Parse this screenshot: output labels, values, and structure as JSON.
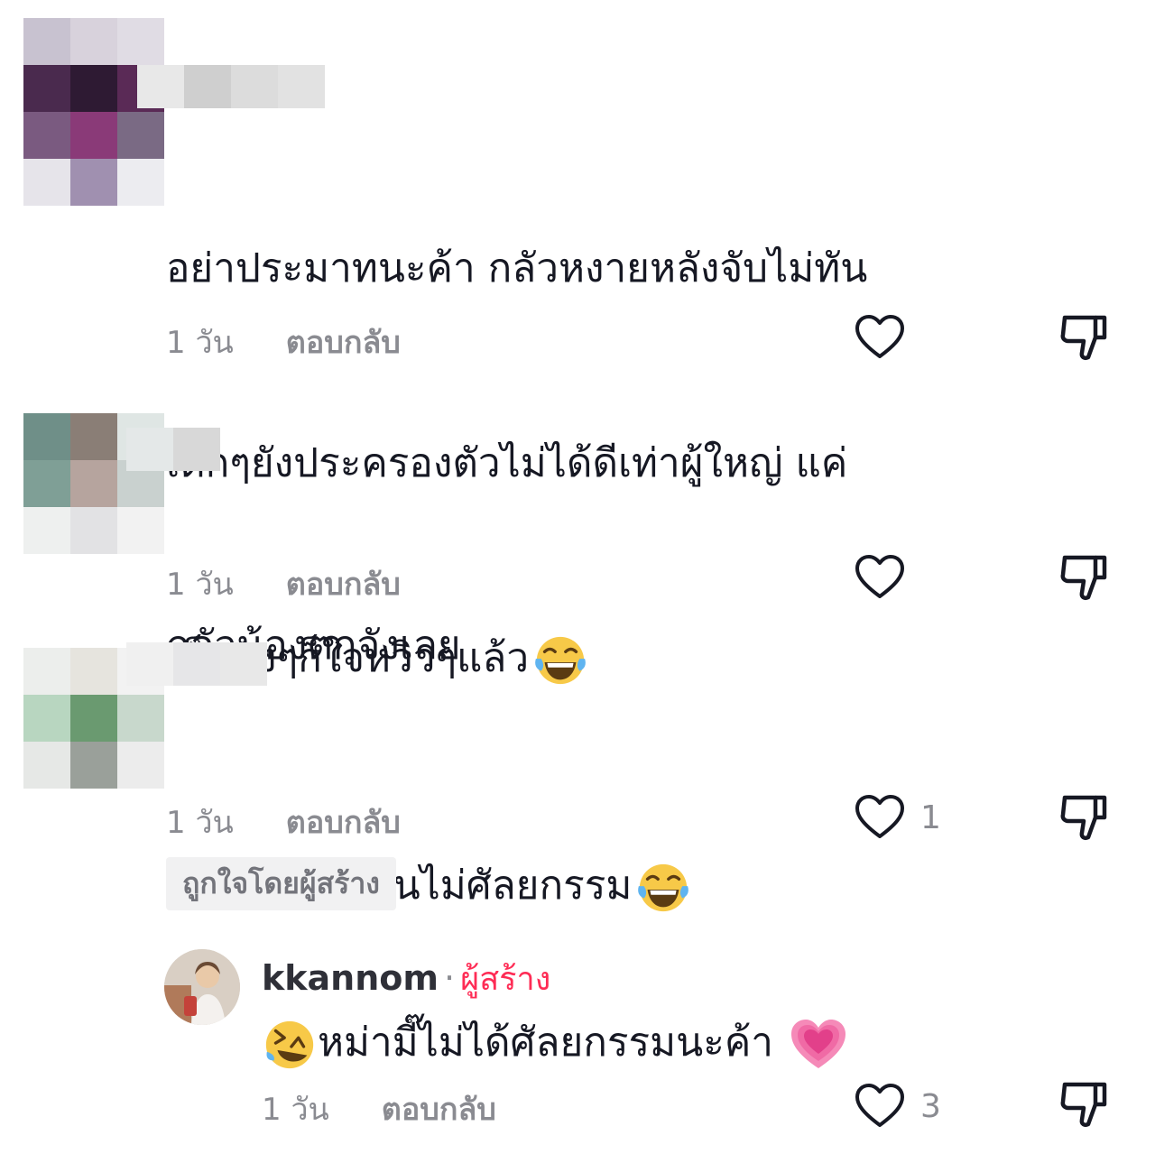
{
  "colors": {
    "accent": "#fe2c55",
    "muted": "#8a8b91",
    "text": "#161823"
  },
  "comments": [
    {
      "text_lines": [
        "อย่าประมาทนะค้า กลัวหงายหลังจับไม่ทัน",
        "เด็กๆยังประครองตัวไม่ได้ดีเท่าผู้ใหญ่ แค่",
        "เห็นสูงๆก็ใจหวิวๆแล้ว"
      ],
      "emoji": "face-with-tears-of-joy",
      "time": "1 วัน",
      "reply_label": "ตอบกลับ",
      "like_count": ""
    },
    {
      "text_lines": [
        "กลัวน้องตกจังเลย"
      ],
      "time": "1 วัน",
      "reply_label": "ตอบกลับ",
      "like_count": ""
    },
    {
      "text_lines": [
        "หน้าพ่อแม่ตอนไม่ศัลยกรรม"
      ],
      "emoji": "face-with-tears-of-joy",
      "time": "1 วัน",
      "reply_label": "ตอบกลับ",
      "like_count": "1",
      "badge": "ถูกใจโดยผู้สร้าง"
    }
  ],
  "reply": {
    "username": "kkannom",
    "separator": "·",
    "creator_label": "ผู้สร้าง",
    "text": "หม่ามี๊ไม่ได้ศัลยกรรมนะค้า",
    "emoji_leading": "rolling-on-floor-laughing",
    "emoji_trailing": "growing-heart",
    "time": "1 วัน",
    "reply_label": "ตอบกลับ",
    "like_count": "3"
  }
}
